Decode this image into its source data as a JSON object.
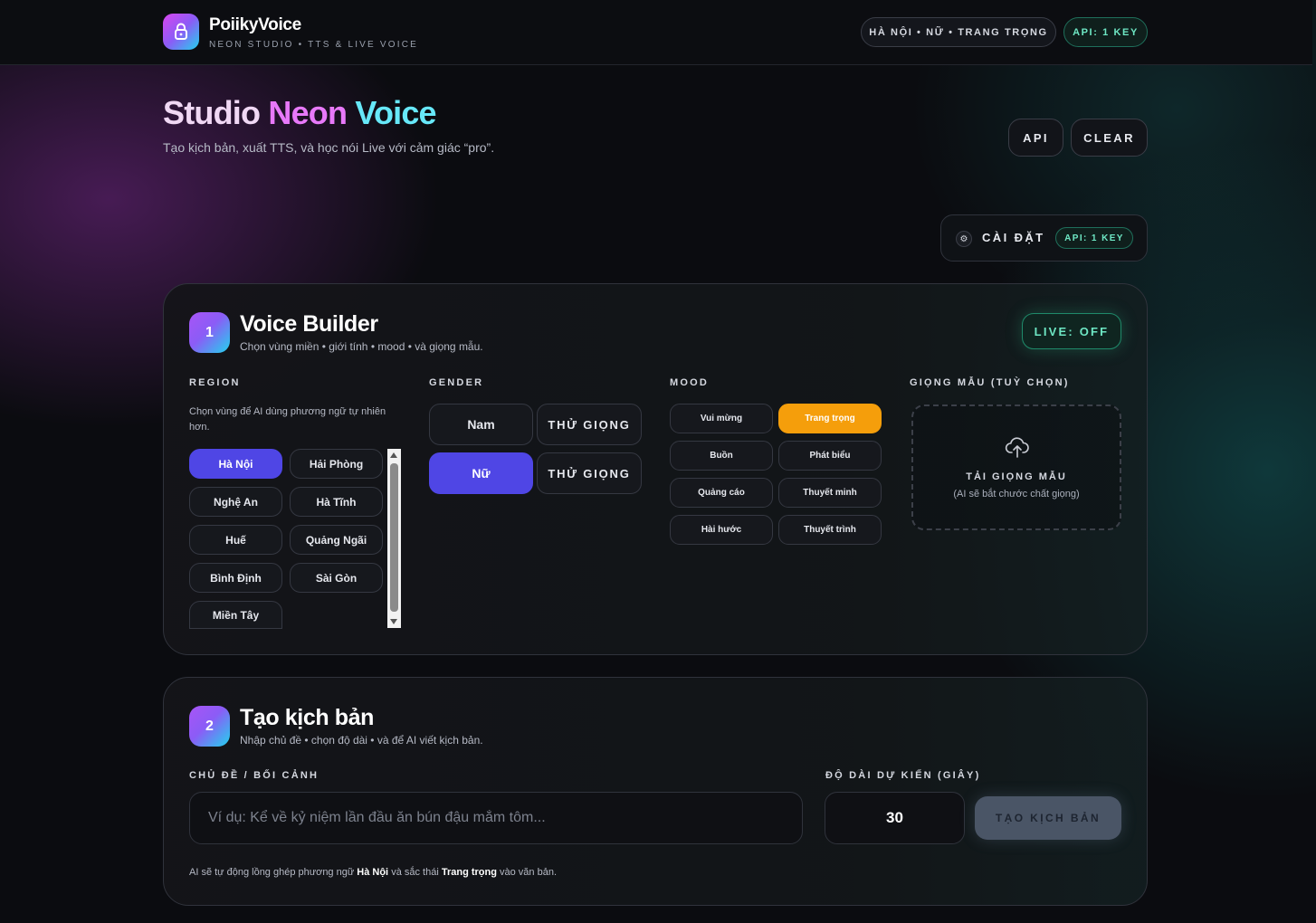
{
  "header": {
    "brand": "PoiikyVoice",
    "tagline": "NEON STUDIO • TTS & LIVE VOICE",
    "status_pill": "HÀ NỘI • NỮ • TRANG TRỌNG",
    "api_pill": "API: 1 KEY"
  },
  "hero": {
    "title_part1": "Studio",
    "title_part2": "Neon",
    "title_part3": "Voice",
    "subtitle": "Tạo kịch bản, xuất TTS, và học nói Live với cảm giác “pro”.",
    "api_button": "API",
    "clear_button": "CLEAR"
  },
  "settings": {
    "label": "CÀI ĐẶT",
    "badge": "API: 1 KEY"
  },
  "voice_builder": {
    "step": "1",
    "title": "Voice Builder",
    "subtitle": "Chọn vùng miền • giới tính • mood • và giọng mẫu.",
    "live_button": "LIVE: OFF",
    "region": {
      "label": "REGION",
      "description": "Chọn vùng để AI dùng phương ngữ tự nhiên hơn.",
      "items": [
        "Hà Nội",
        "Hải Phòng",
        "Nghệ An",
        "Hà Tĩnh",
        "Huế",
        "Quảng Ngãi",
        "Bình Định",
        "Sài Gòn",
        "Miền Tây"
      ],
      "selected": "Hà Nội"
    },
    "gender": {
      "label": "GENDER",
      "options": [
        "Nam",
        "Nữ"
      ],
      "try_label": "THỬ GIỌNG",
      "selected": "Nữ"
    },
    "mood": {
      "label": "MOOD",
      "items": [
        "Vui mừng",
        "Trang trọng",
        "Buồn",
        "Phát biểu",
        "Quảng cáo",
        "Thuyết minh",
        "Hài hước",
        "Thuyết trình"
      ],
      "selected": "Trang trọng"
    },
    "sample_voice": {
      "label": "GIỌNG MẪU (TUỲ CHỌN)",
      "upload_title": "TẢI GIỌNG MẪU",
      "upload_sub": "(AI sẽ bắt chước chất giọng)"
    }
  },
  "script_builder": {
    "step": "2",
    "title": "Tạo kịch bản",
    "subtitle": "Nhập chủ đề • chọn độ dài • và để AI viết kịch bản.",
    "topic_label": "CHỦ ĐỀ / BỐI CẢNH",
    "topic_placeholder": "Ví dụ: Kể về kỷ niệm lần đầu ăn bún đậu mắm tôm...",
    "duration_label": "ĐỘ DÀI DỰ KIẾN (GIÂY)",
    "duration_value": "30",
    "generate_button": "TẠO KỊCH BẢN",
    "note_prefix": "AI sẽ tự động lồng ghép phương ngữ",
    "note_region": "Hà Nội",
    "note_middle": "và sắc thái",
    "note_mood": "Trang trọng",
    "note_suffix": "vào văn bản."
  }
}
